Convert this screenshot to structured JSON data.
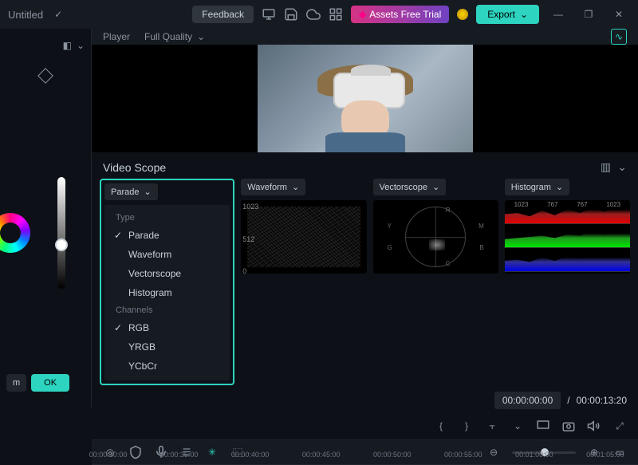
{
  "titlebar": {
    "title": "Untitled",
    "feedback": "Feedback",
    "assets": "Assets Free Trial",
    "export": "Export"
  },
  "player": {
    "label": "Player",
    "quality": "Full Quality"
  },
  "leftpanel": {
    "ok": "OK",
    "m": "m"
  },
  "scope": {
    "title": "Video Scope",
    "scopes": [
      {
        "label": "Parade"
      },
      {
        "label": "Waveform"
      },
      {
        "label": "Vectorscope"
      },
      {
        "label": "Histogram"
      }
    ],
    "dropdown": {
      "type_header": "Type",
      "type_items": [
        "Parade",
        "Waveform",
        "Vectorscope",
        "Histogram"
      ],
      "channels_header": "Channels",
      "channel_items": [
        "RGB",
        "YRGB",
        "YCbCr"
      ],
      "selected_type": "Parade",
      "selected_channel": "RGB"
    },
    "waveform_labels": {
      "top": "1023",
      "mid": "512",
      "bot": "0"
    },
    "vectorscope_labels": [
      "R",
      "M",
      "B",
      "C",
      "G",
      "Y"
    ],
    "histogram_labels": [
      "1023",
      "767",
      "767",
      "1023"
    ]
  },
  "timecode": {
    "current": "00:00:00:00",
    "sep": "/",
    "total": "00:00:13:20"
  },
  "ruler": {
    "marks": [
      "00:00:30:00",
      "00:00:35:00",
      "00:00:40:00",
      "00:00:45:00",
      "00:00:50:00",
      "00:00:55:00",
      "00:01:00:00",
      "00:01:05:00"
    ]
  }
}
